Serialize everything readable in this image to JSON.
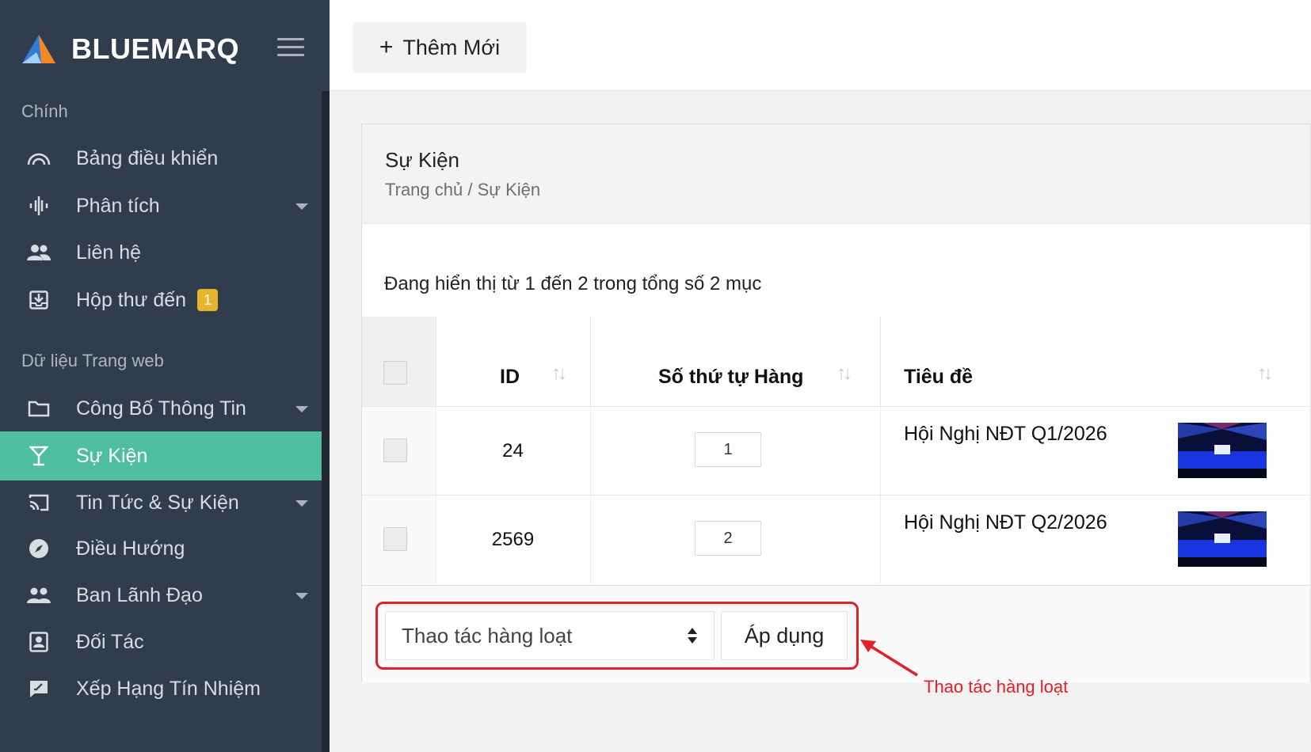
{
  "brand": {
    "name": "BLUEMARQ"
  },
  "sidebar": {
    "sections": [
      {
        "label": "Chính"
      },
      {
        "label": "Dữ liệu Trang web"
      }
    ],
    "items": [
      {
        "label": "Bảng điều khiển",
        "icon": "dashboard-icon"
      },
      {
        "label": "Phân tích",
        "icon": "analytics-icon",
        "has_submenu": true
      },
      {
        "label": "Liên hệ",
        "icon": "contacts-icon"
      },
      {
        "label": "Hộp thư đến",
        "icon": "inbox-icon",
        "badge": "1"
      },
      {
        "label": "Công Bố Thông Tin",
        "icon": "folder-icon",
        "has_submenu": true
      },
      {
        "label": "Sự Kiện",
        "icon": "cocktail-glass-icon",
        "active": true
      },
      {
        "label": "Tin Tức & Sự Kiện",
        "icon": "cast-icon",
        "has_submenu": true
      },
      {
        "label": "Điều Hướng",
        "icon": "compass-icon"
      },
      {
        "label": "Ban Lãnh Đạo",
        "icon": "people-icon",
        "has_submenu": true
      },
      {
        "label": "Đối Tác",
        "icon": "contact-card-icon"
      },
      {
        "label": "Xếp Hạng Tín Nhiệm",
        "icon": "rating-icon"
      }
    ]
  },
  "topbar": {
    "add_button_label": "Thêm Mới"
  },
  "page": {
    "title": "Sự Kiện",
    "breadcrumb": "Trang chủ / Sự Kiện",
    "summary": "Đang hiển thị từ 1 đến 2 trong tổng số 2 mục"
  },
  "table": {
    "columns": [
      "ID",
      "Số thứ tự Hàng",
      "Tiêu đề"
    ],
    "rows": [
      {
        "id": "24",
        "order": "1",
        "title": "Hội Nghị NĐT Q1/2026"
      },
      {
        "id": "2569",
        "order": "2",
        "title": "Hội Nghị NĐT Q2/2026"
      }
    ]
  },
  "bulk": {
    "select_value": "Thao tác hàng loạt",
    "apply_label": "Áp dụng"
  },
  "annotation": {
    "text": "Thao tác hàng loạt",
    "color": "#e0202a"
  },
  "colors": {
    "sidebar_bg": "#313d4c",
    "active_item": "#4dbf9c",
    "badge": "#e6b52e"
  }
}
